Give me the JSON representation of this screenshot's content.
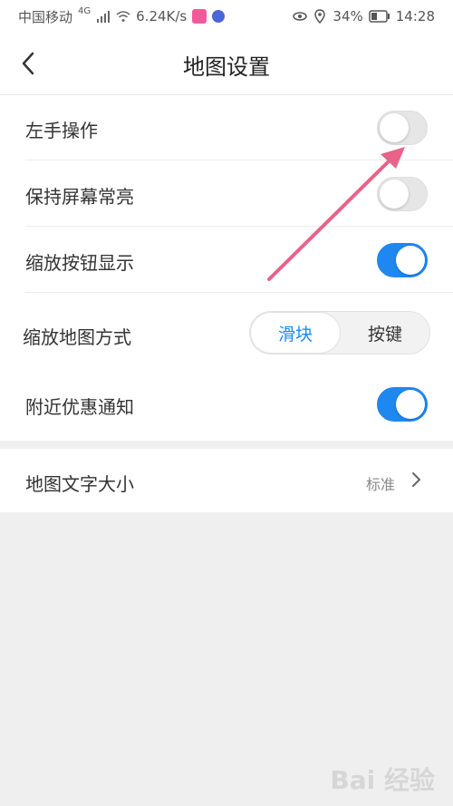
{
  "status_bar": {
    "carrier": "中国移动",
    "signal_tag": "4G",
    "net_speed": "6.24K/s",
    "battery": "34%",
    "time": "14:28"
  },
  "header": {
    "title": "地图设置"
  },
  "settings": [
    {
      "label": "左手操作",
      "control": "toggle",
      "state": "off"
    },
    {
      "label": "保持屏幕常亮",
      "control": "toggle",
      "state": "off"
    },
    {
      "label": "缩放按钮显示",
      "control": "toggle",
      "state": "on"
    },
    {
      "label": "缩放地图方式",
      "control": "segmented",
      "options": [
        "滑块",
        "按键"
      ],
      "selected": "滑块"
    },
    {
      "label": "附近优惠通知",
      "control": "toggle",
      "state": "on"
    }
  ],
  "font_size_row": {
    "label": "地图文字大小",
    "value": "标准"
  },
  "watermark": "Bai 经验",
  "colors": {
    "accent": "#1e88f0",
    "annotation_arrow": "#e8628a"
  }
}
